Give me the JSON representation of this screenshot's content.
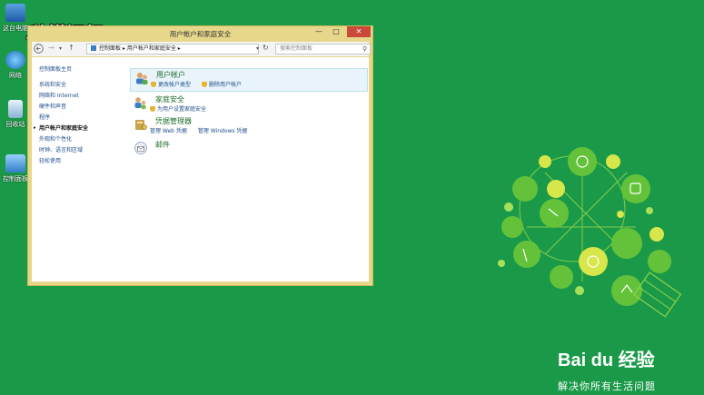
{
  "watermark": "秒懂视频",
  "desktop_icons": [
    {
      "label": "这台电脑",
      "icon": "computer-icon"
    },
    {
      "label": "网络",
      "icon": "network-icon"
    },
    {
      "label": "回收站",
      "icon": "recycle-bin-icon"
    },
    {
      "label": "控制面板",
      "icon": "control-panel-icon"
    }
  ],
  "window": {
    "title": "用户帐户和家庭安全",
    "minimize": "—",
    "maximize": "□",
    "close": "✕"
  },
  "addressbar": {
    "path": "控制面板 ▸ 用户帐户和家庭安全 ▸",
    "search_placeholder": "搜索控制面板"
  },
  "sidebar": {
    "home": "控制面板主页",
    "items": [
      {
        "label": "系统和安全",
        "current": false
      },
      {
        "label": "网络和 Internet",
        "current": false
      },
      {
        "label": "硬件和声音",
        "current": false
      },
      {
        "label": "程序",
        "current": false
      },
      {
        "label": "用户帐户和家庭安全",
        "current": true
      },
      {
        "label": "外观和个性化",
        "current": false
      },
      {
        "label": "时钟、语言和区域",
        "current": false
      },
      {
        "label": "轻松使用",
        "current": false
      }
    ]
  },
  "categories": [
    {
      "title": "用户帐户",
      "links": [
        "更改帐户类型",
        "删除用户帐户"
      ],
      "selected": true
    },
    {
      "title": "家庭安全",
      "links": [
        "为用户设置家庭安全"
      ],
      "selected": false
    },
    {
      "title": "凭据管理器",
      "links": [
        "管理 Web 凭据",
        "管理 Windows 凭据"
      ],
      "selected": false
    },
    {
      "title": "邮件",
      "links": [],
      "selected": false
    }
  ],
  "branding": {
    "logo": "Bai du 经验",
    "tagline": "解决你所有生活问题"
  },
  "colors": {
    "desktop": "#1a9a48",
    "window_frame": "#e6d78a",
    "link": "#1f4e8c",
    "category_title": "#1e6d2a",
    "close_button": "#c94a3a"
  }
}
